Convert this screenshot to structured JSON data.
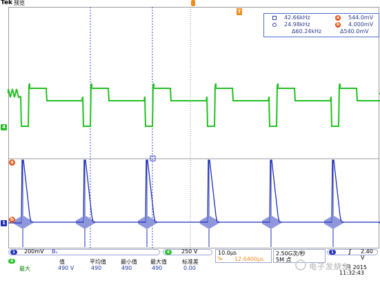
{
  "header": {
    "brand": "Tek",
    "mode": "预览"
  },
  "cursor_readout": {
    "row1": {
      "left": "42.66kHz",
      "badge": "a",
      "right": "544.0mV"
    },
    "row2": {
      "left": "24.98kHz",
      "badge": "b",
      "right": "4.000mV"
    },
    "row3": {
      "left": "Δ60.24kHz",
      "right": "Δ540.0mV"
    }
  },
  "markers": {
    "ch4": "4",
    "ch1": "1",
    "ref_a": "a",
    "ref_b": "b",
    "trigger": "T"
  },
  "channel1": {
    "num": "1",
    "scale": "200mV",
    "bw": "Bᵥ"
  },
  "channel4": {
    "num": "4",
    "scale": "250 V"
  },
  "measure": {
    "source": "4",
    "name": "最大",
    "headers": [
      "值",
      "平均值",
      "最小值",
      "最大值",
      "标准差"
    ],
    "values": [
      "490 V",
      "490",
      "490",
      "490",
      "0.00"
    ]
  },
  "timebase": {
    "div": "10.0µs",
    "trig_pos": "12.6400µs",
    "trig_icon": "T▸"
  },
  "acquisition": {
    "rate": "2.50G次/秒",
    "length": "5M 点"
  },
  "trigger": {
    "source": "1",
    "slope": "∫",
    "level": "2.40 V"
  },
  "datetime": {
    "date": "7月 2015",
    "time": "11:32:43"
  },
  "watermark": {
    "text": "电子发烧友"
  },
  "colors": {
    "ch1": "#1f2fb8",
    "ch4": "#21c021",
    "ref": "#e0551a",
    "trigger": "#f08c1e"
  }
}
